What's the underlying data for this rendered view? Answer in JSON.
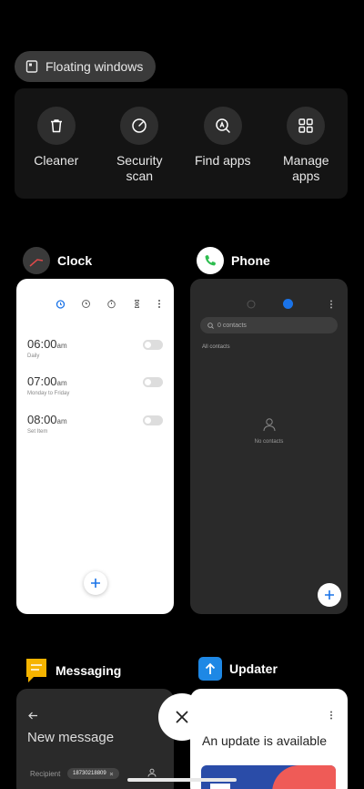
{
  "floating": {
    "label": "Floating windows"
  },
  "shortcuts": [
    {
      "label": "Cleaner",
      "icon": "trash-icon"
    },
    {
      "label": "Security\nscan",
      "icon": "security-icon"
    },
    {
      "label": "Find apps",
      "icon": "search-app-icon"
    },
    {
      "label": "Manage\napps",
      "icon": "grid-icon"
    }
  ],
  "apps": {
    "clock": {
      "name": "Clock",
      "alarms": [
        {
          "time": "06:00",
          "ampm": "am",
          "sub": "Daily"
        },
        {
          "time": "07:00",
          "ampm": "am",
          "sub": "Monday to Friday"
        },
        {
          "time": "08:00",
          "ampm": "am",
          "sub": "Set Item"
        }
      ]
    },
    "phone": {
      "name": "Phone",
      "search_placeholder": "0 contacts",
      "section": "All contacts",
      "empty": "No contacts"
    },
    "messaging": {
      "name": "Messaging",
      "title": "New message",
      "recipient_label": "Recipient",
      "recipient_chip": "18730218809"
    },
    "updater": {
      "name": "Updater",
      "title": "An update is available"
    }
  },
  "colors": {
    "accent": "#1a73e8",
    "phone_green": "#2dbd4f",
    "messaging_yellow": "#f6b400",
    "updater_blue": "#1e88e5"
  }
}
